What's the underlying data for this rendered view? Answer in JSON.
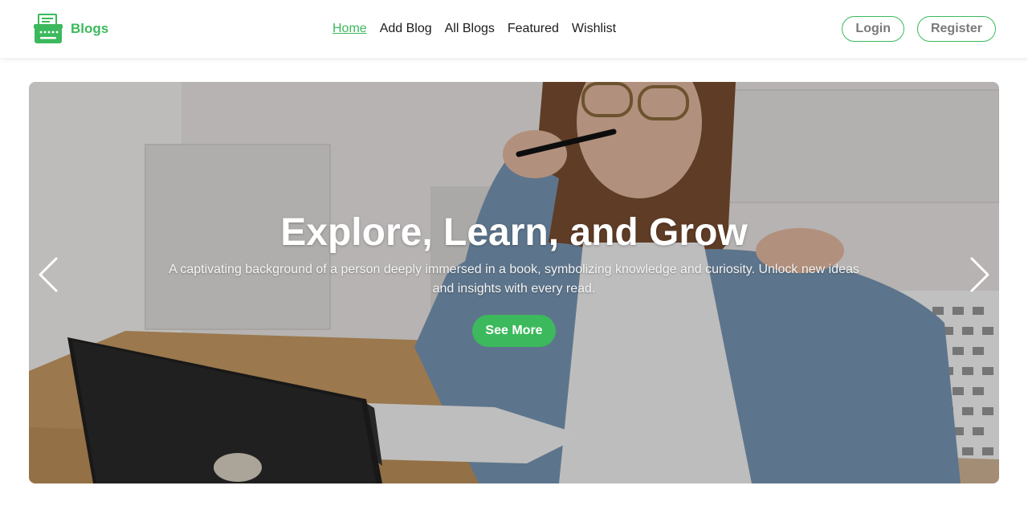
{
  "header": {
    "brand": {
      "name": "Blogs",
      "icon": "typewriter-icon"
    },
    "nav": [
      {
        "label": "Home",
        "active": true
      },
      {
        "label": "Add Blog",
        "active": false
      },
      {
        "label": "All Blogs",
        "active": false
      },
      {
        "label": "Featured",
        "active": false
      },
      {
        "label": "Wishlist",
        "active": false
      }
    ],
    "login_label": "Login",
    "register_label": "Register"
  },
  "hero": {
    "title": "Explore, Learn, and Grow",
    "description": "A captivating background of a person deeply immersed in a book, symbolizing knowledge and curiosity. Unlock new ideas and insights with every read.",
    "cta_label": "See More",
    "prev_icon": "chevron-left-icon",
    "next_icon": "chevron-right-icon"
  },
  "colors": {
    "accent": "#3cb95c",
    "nav_text": "#1c1c1c",
    "auth_text": "#7a7a7a"
  }
}
